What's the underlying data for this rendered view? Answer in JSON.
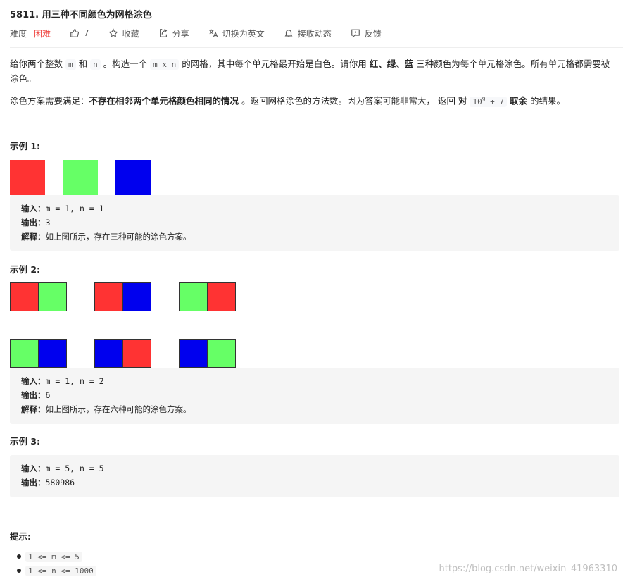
{
  "problem": {
    "title": "5811. 用三种不同颜色为网格涂色"
  },
  "toolbar": {
    "difficulty_label": "难度",
    "difficulty_value": "困难",
    "like_count": "7",
    "favorite_label": "收藏",
    "share_label": "分享",
    "translate_label": "切换为英文",
    "subscribe_label": "接收动态",
    "feedback_label": "反馈"
  },
  "description": {
    "p1_a": "给你两个整数 ",
    "m": "m",
    "p1_b": " 和 ",
    "n": "n",
    "p1_c": " 。构造一个 ",
    "mxn": "m x n",
    "p1_d": " 的网格，其中每个单元格最开始是白色。请你用 ",
    "colors_bold": "红、绿、蓝",
    "p1_e": " 三种颜色为每个单元格涂色。所有单元格都需要被涂色。",
    "p2_a": "涂色方案需要满足：",
    "p2_bold": "不存在相邻两个单元格颜色相同的情况",
    "p2_b": " 。返回网格涂色的方法数。因为答案可能非常大， 返回 ",
    "dui": "对",
    "mod_base": "10",
    "mod_exp": "9",
    "mod_rest": " + 7",
    "quyu": "取余",
    "p2_c": " 的结果。"
  },
  "examples": [
    {
      "heading": "示例 1:",
      "input_label": "输入：",
      "input_value": "m = 1, n = 1",
      "output_label": "输出：",
      "output_value": "3",
      "explain_label": "解释：",
      "explain_value": "如上图所示，存在三种可能的涂色方案。"
    },
    {
      "heading": "示例 2:",
      "input_label": "输入：",
      "input_value": "m = 1, n = 2",
      "output_label": "输出：",
      "output_value": "6",
      "explain_label": "解释：",
      "explain_value": "如上图所示，存在六种可能的涂色方案。"
    },
    {
      "heading": "示例 3:",
      "input_label": "输入：",
      "input_value": "m = 5, n = 5",
      "output_label": "输出：",
      "output_value": "580986"
    }
  ],
  "colors": {
    "red": "#ff3333",
    "green": "#66ff66",
    "blue": "#0000ee",
    "difficulty_hard": "#ef4743"
  },
  "example1_cells": [
    "red",
    "green",
    "blue"
  ],
  "example2_pairs": [
    [
      "red",
      "green"
    ],
    [
      "red",
      "blue"
    ],
    [
      "green",
      "red"
    ],
    [
      "green",
      "blue"
    ],
    [
      "blue",
      "red"
    ],
    [
      "blue",
      "green"
    ]
  ],
  "hints": {
    "heading": "提示:",
    "items": [
      "1 <= m <= 5",
      "1 <= n <= 1000"
    ]
  },
  "watermark": "https://blog.csdn.net/weixin_41963310"
}
